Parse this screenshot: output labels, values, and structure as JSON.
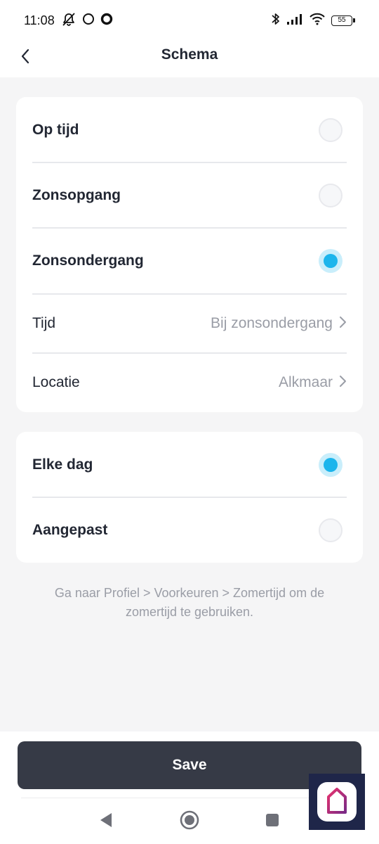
{
  "status_bar": {
    "time": "11:08",
    "battery": "55"
  },
  "header": {
    "title": "Schema"
  },
  "trigger_options": [
    {
      "label": "Op tijd",
      "selected": false
    },
    {
      "label": "Zonsopgang",
      "selected": false
    },
    {
      "label": "Zonsondergang",
      "selected": true
    }
  ],
  "details": {
    "time": {
      "label": "Tijd",
      "value": "Bij zonsondergang"
    },
    "location": {
      "label": "Locatie",
      "value": "Alkmaar"
    }
  },
  "repeat_options": [
    {
      "label": "Elke dag",
      "selected": true
    },
    {
      "label": "Aangepast",
      "selected": false
    }
  ],
  "hint": "Ga naar Profiel > Voorkeuren > Zomertijd om de zomertijd te gebruiken.",
  "save_label": "Save",
  "colors": {
    "accent": "#1cb5ec",
    "button": "#363a46",
    "background": "#f5f5f6"
  }
}
